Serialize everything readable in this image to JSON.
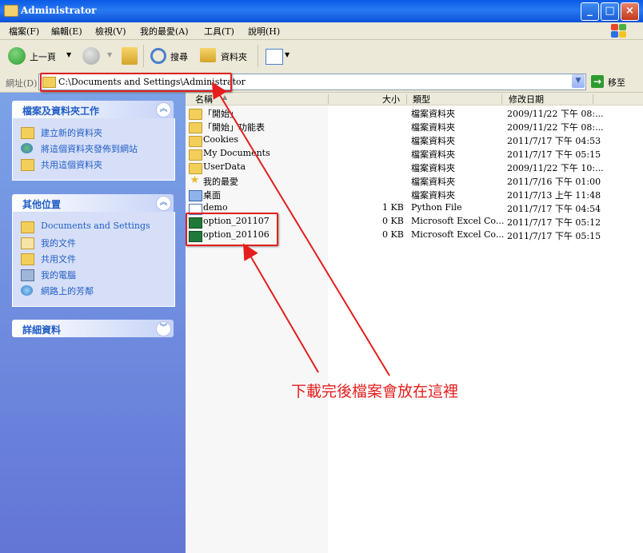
{
  "window": {
    "title": "Administrator",
    "colors": {
      "titlebar": "#0a5ae6",
      "task_link": "#215dc6",
      "annotation": "#e51d1d"
    }
  },
  "menu": {
    "items": [
      "檔案(F)",
      "編輯(E)",
      "檢視(V)",
      "我的最愛(A)",
      "工具(T)",
      "說明(H)"
    ]
  },
  "toolbar": {
    "back_label": "上一頁",
    "search_label": "搜尋",
    "folders_label": "資料夾"
  },
  "address": {
    "label": "網址(D)",
    "value": "C:\\Documents and Settings\\Administrator",
    "go_label": "移至"
  },
  "left_panel": {
    "tasks": {
      "title": "檔案及資料夾工作",
      "items": [
        "建立新的資料夾",
        "將這個資料夾發佈到網站",
        "共用這個資料夾"
      ]
    },
    "places": {
      "title": "其他位置",
      "items": [
        "Documents and Settings",
        "我的文件",
        "共用文件",
        "我的電腦",
        "網路上的芳鄰"
      ]
    },
    "details": {
      "title": "詳細資料"
    }
  },
  "file_list": {
    "columns": [
      "名稱",
      "大小",
      "類型",
      "修改日期"
    ],
    "rows": [
      {
        "name": "「開始」",
        "size": "",
        "type": "檔案資料夾",
        "date": "2009/11/22 下午 08:...",
        "icon": "folder-icon"
      },
      {
        "name": "「開始」功能表",
        "size": "",
        "type": "檔案資料夾",
        "date": "2009/11/22 下午 08:...",
        "icon": "folder-icon"
      },
      {
        "name": "Cookies",
        "size": "",
        "type": "檔案資料夾",
        "date": "2011/7/17 下午 04:53",
        "icon": "folder-icon"
      },
      {
        "name": "My Documents",
        "size": "",
        "type": "檔案資料夾",
        "date": "2011/7/17 下午 05:15",
        "icon": "folder-icon"
      },
      {
        "name": "UserData",
        "size": "",
        "type": "檔案資料夾",
        "date": "2009/11/22 下午 10:...",
        "icon": "folder-icon"
      },
      {
        "name": "我的最愛",
        "size": "",
        "type": "檔案資料夾",
        "date": "2011/7/16 下午 01:00",
        "icon": "favorites-icon"
      },
      {
        "name": "桌面",
        "size": "",
        "type": "檔案資料夾",
        "date": "2011/7/13 上午 11:48",
        "icon": "desktop-icon"
      },
      {
        "name": "demo",
        "size": "1 KB",
        "type": "Python File",
        "date": "2011/7/17 下午 04:54",
        "icon": "python-file-icon"
      },
      {
        "name": "option_201107",
        "size": "0 KB",
        "type": "Microsoft Excel Co...",
        "date": "2011/7/17 下午 05:12",
        "icon": "excel-file-icon"
      },
      {
        "name": "option_201106",
        "size": "0 KB",
        "type": "Microsoft Excel Co...",
        "date": "2011/7/17 下午 05:15",
        "icon": "excel-file-icon"
      }
    ]
  },
  "annotation": {
    "text": "下載完後檔案會放在這裡"
  }
}
